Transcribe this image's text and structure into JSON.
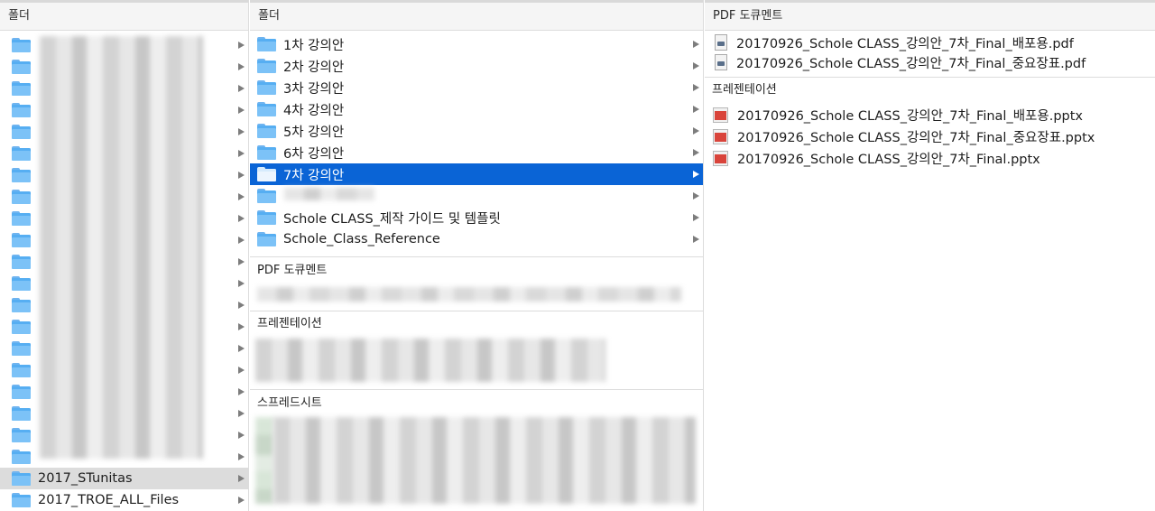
{
  "columns": {
    "col1_header": "폴더",
    "col2_header": "폴더",
    "col3_header": "PDF 도큐멘트"
  },
  "col1": {
    "selected_item": "2017_STunitas",
    "last_item": "2017_TROE_ALL_Files"
  },
  "col2": {
    "folders": [
      {
        "label": "1차 강의안"
      },
      {
        "label": "2차 강의안"
      },
      {
        "label": "3차 강의안"
      },
      {
        "label": "4차 강의안"
      },
      {
        "label": "5차 강의안"
      },
      {
        "label": "6차 강의안"
      },
      {
        "label": "7차 강의안"
      },
      {
        "label": ""
      },
      {
        "label": "Schole CLASS_제작 가이드 및 템플릿"
      },
      {
        "label": "Schole_Class_Reference"
      }
    ],
    "selected_index": 6,
    "sections": {
      "pdf": "PDF 도큐멘트",
      "presentation": "프레젠테이션",
      "spreadsheet": "스프레드시트"
    }
  },
  "col3": {
    "pdf_files": [
      {
        "label": "20170926_Schole CLASS_강의안_7차_Final_배포용.pdf",
        "icon": "pdf-icon"
      },
      {
        "label": "20170926_Schole CLASS_강의안_7차_Final_중요장표.pdf",
        "icon": "pdf-icon"
      }
    ],
    "presentation_section": "프레젠테이션",
    "pptx_files": [
      {
        "label": "20170926_Schole CLASS_강의안_7차_Final_배포용.pptx",
        "icon": "pptx-icon"
      },
      {
        "label": "20170926_Schole CLASS_강의안_7차_Final_중요장표.pptx",
        "icon": "pptx-icon"
      },
      {
        "label": "20170926_Schole CLASS_강의안_7차_Final.pptx",
        "icon": "pptx-icon"
      }
    ]
  },
  "colors": {
    "selection": "#0a64d6",
    "parent_selection": "#dcdcdc",
    "folder_blue": "#56aef2",
    "pptx_red": "#d9443b"
  }
}
